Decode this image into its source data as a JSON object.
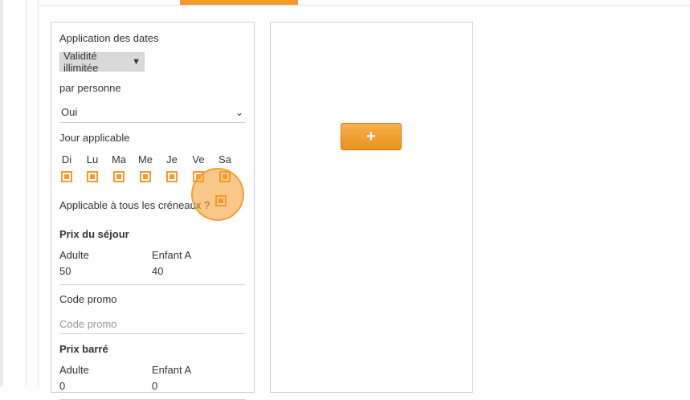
{
  "tabs": {
    "active_indicator": ""
  },
  "form": {
    "date_application": {
      "label": "Application des dates",
      "value": "Validité illimitée"
    },
    "per_person": {
      "label": "par personne",
      "value": "Oui"
    },
    "day_applicable": {
      "label": "Jour applicable",
      "days": [
        "Di",
        "Lu",
        "Ma",
        "Me",
        "Je",
        "Ve",
        "Sa"
      ]
    },
    "all_slots": {
      "label": "Applicable à tous les créneaux ?"
    },
    "stay_price": {
      "title": "Prix du séjour",
      "adult_label": "Adulte",
      "child_label": "Enfant A",
      "adult_value": "50",
      "child_value": "40"
    },
    "promo": {
      "label": "Code promo",
      "placeholder": "Code promo"
    },
    "strike_price": {
      "title": "Prix barré",
      "adult_label": "Adulte",
      "child_label": "Enfant A",
      "adult_value": "0",
      "child_value": "0"
    }
  },
  "actions": {
    "add_label": "+"
  },
  "colors": {
    "accent": "#f39a2a",
    "border": "#cfcfcf",
    "text": "#333333"
  }
}
